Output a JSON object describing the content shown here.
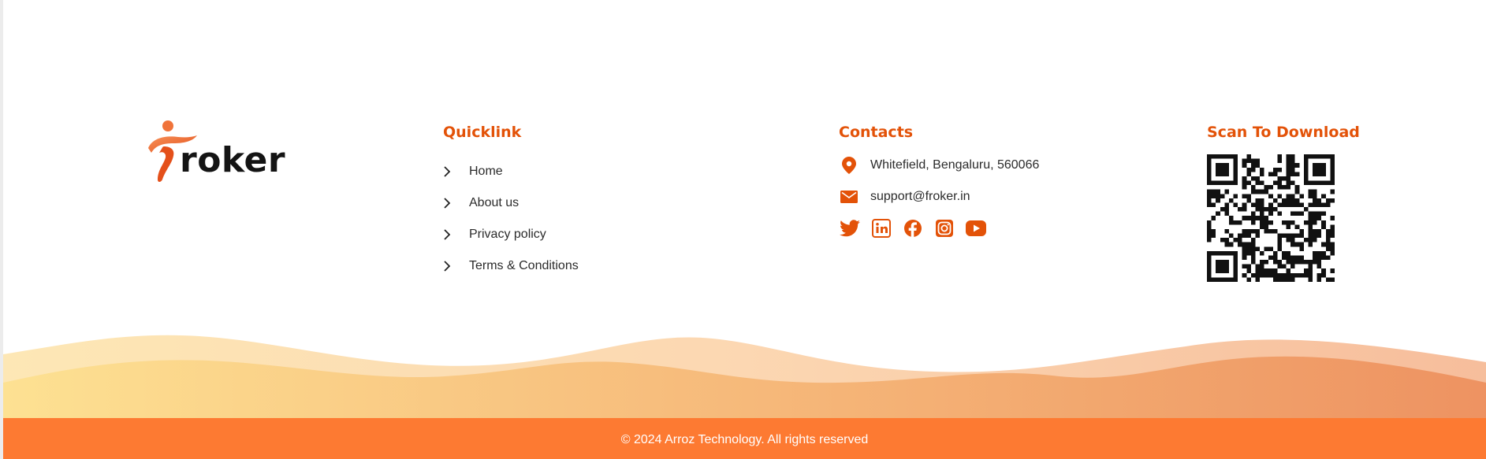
{
  "brand": {
    "name": "roker",
    "logo_icon": "froker-runner-logo",
    "colors": {
      "accent": "#e35208",
      "bar": "#fd7a32",
      "text": "#2b2b2b"
    }
  },
  "quicklinks": {
    "title": "Quicklink",
    "items": [
      {
        "label": "Home",
        "icon": "chevron-right-icon"
      },
      {
        "label": "About us",
        "icon": "chevron-right-icon"
      },
      {
        "label": "Privacy policy",
        "icon": "chevron-right-icon"
      },
      {
        "label": "Terms & Conditions",
        "icon": "chevron-right-icon"
      }
    ]
  },
  "contacts": {
    "title": "Contacts",
    "address": {
      "text": "Whitefield, Bengaluru, 560066",
      "icon": "location-pin-icon"
    },
    "email": {
      "text": "support@froker.in",
      "icon": "envelope-icon"
    },
    "social": [
      "twitter-icon",
      "linkedin-icon",
      "facebook-icon",
      "instagram-icon",
      "youtube-icon"
    ]
  },
  "download": {
    "title": "Scan To Download",
    "qr": "qr-code"
  },
  "footer": {
    "copyright": "© 2024 Arroz Technology. All rights reserved"
  }
}
